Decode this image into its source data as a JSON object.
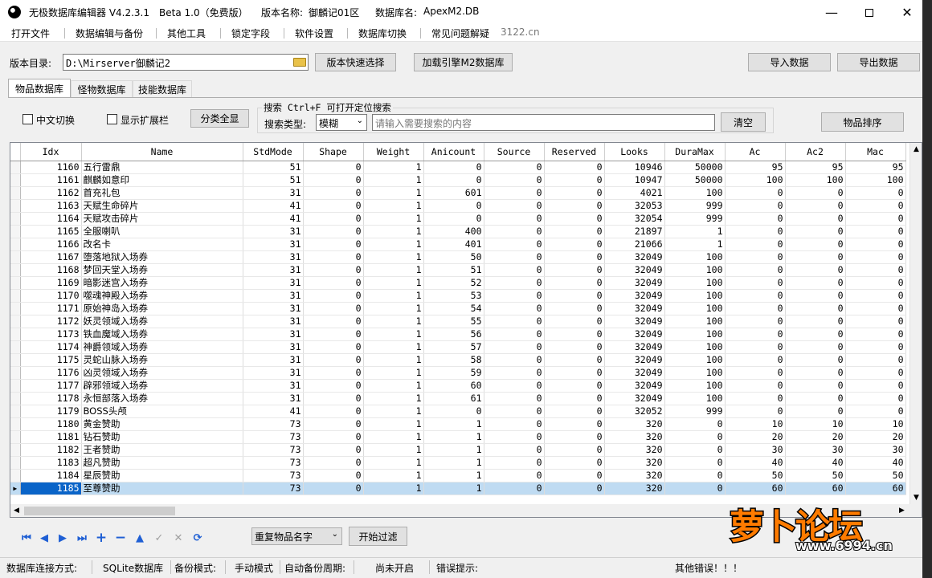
{
  "titlebar": {
    "app_name": "无极数据库编辑器 V4.2.3.1",
    "edition": "Beta 1.0（免费版）",
    "version_label": "版本名称:",
    "version_value": "御麟记01区",
    "db_label": "数据库名:",
    "db_value": "ApexM2.DB"
  },
  "menu": [
    "打开文件",
    "数据编辑与备份",
    "其他工具",
    "锁定字段",
    "软件设置",
    "数据库切换",
    "常见问题解疑"
  ],
  "menu_site": "3122.cn",
  "toolbar": {
    "dir_label": "版本目录:",
    "dir_value": "D:\\Mirserver御麟记2",
    "quick_select": "版本快速选择",
    "load_db": "加载引擎M2数据库",
    "import": "导入数据",
    "export": "导出数据"
  },
  "tabs": [
    "物品数据库",
    "怪物数据库",
    "技能数据库"
  ],
  "filters": {
    "chinese_toggle": "中文切换",
    "show_ext": "显示扩展栏",
    "show_all": "分类全显",
    "search_title": "搜索  Ctrl+F 可打开定位搜索",
    "search_type_label": "搜索类型:",
    "search_type_value": "模糊",
    "search_placeholder": "请输入需要搜索的内容",
    "clear": "清空",
    "sort": "物品排序"
  },
  "grid": {
    "columns": [
      "Idx",
      "Name",
      "StdMode",
      "Shape",
      "Weight",
      "Anicount",
      "Source",
      "Reserved",
      "Looks",
      "DuraMax",
      "Ac",
      "Ac2",
      "Mac"
    ],
    "rows": [
      [
        "1160",
        "五行雷鼎",
        "51",
        "0",
        "1",
        "0",
        "0",
        "0",
        "10946",
        "50000",
        "95",
        "95",
        "95"
      ],
      [
        "1161",
        "麒麟如意印",
        "51",
        "0",
        "1",
        "0",
        "0",
        "0",
        "10947",
        "50000",
        "100",
        "100",
        "100"
      ],
      [
        "1162",
        "首充礼包",
        "31",
        "0",
        "1",
        "601",
        "0",
        "0",
        "4021",
        "100",
        "0",
        "0",
        "0"
      ],
      [
        "1163",
        "天赋生命碎片",
        "41",
        "0",
        "1",
        "0",
        "0",
        "0",
        "32053",
        "999",
        "0",
        "0",
        "0"
      ],
      [
        "1164",
        "天赋攻击碎片",
        "41",
        "0",
        "1",
        "0",
        "0",
        "0",
        "32054",
        "999",
        "0",
        "0",
        "0"
      ],
      [
        "1165",
        "全服喇叭",
        "31",
        "0",
        "1",
        "400",
        "0",
        "0",
        "21897",
        "1",
        "0",
        "0",
        "0"
      ],
      [
        "1166",
        "改名卡",
        "31",
        "0",
        "1",
        "401",
        "0",
        "0",
        "21066",
        "1",
        "0",
        "0",
        "0"
      ],
      [
        "1167",
        "堕落地狱入场券",
        "31",
        "0",
        "1",
        "50",
        "0",
        "0",
        "32049",
        "100",
        "0",
        "0",
        "0"
      ],
      [
        "1168",
        "梦回天堂入场券",
        "31",
        "0",
        "1",
        "51",
        "0",
        "0",
        "32049",
        "100",
        "0",
        "0",
        "0"
      ],
      [
        "1169",
        "暗影迷宫入场券",
        "31",
        "0",
        "1",
        "52",
        "0",
        "0",
        "32049",
        "100",
        "0",
        "0",
        "0"
      ],
      [
        "1170",
        "噬魂神殿入场券",
        "31",
        "0",
        "1",
        "53",
        "0",
        "0",
        "32049",
        "100",
        "0",
        "0",
        "0"
      ],
      [
        "1171",
        "原始神岛入场券",
        "31",
        "0",
        "1",
        "54",
        "0",
        "0",
        "32049",
        "100",
        "0",
        "0",
        "0"
      ],
      [
        "1172",
        "妖灵领域入场券",
        "31",
        "0",
        "1",
        "55",
        "0",
        "0",
        "32049",
        "100",
        "0",
        "0",
        "0"
      ],
      [
        "1173",
        "铁血魔域入场券",
        "31",
        "0",
        "1",
        "56",
        "0",
        "0",
        "32049",
        "100",
        "0",
        "0",
        "0"
      ],
      [
        "1174",
        "神爵领域入场券",
        "31",
        "0",
        "1",
        "57",
        "0",
        "0",
        "32049",
        "100",
        "0",
        "0",
        "0"
      ],
      [
        "1175",
        "灵蛇山脉入场券",
        "31",
        "0",
        "1",
        "58",
        "0",
        "0",
        "32049",
        "100",
        "0",
        "0",
        "0"
      ],
      [
        "1176",
        "凶灵领域入场券",
        "31",
        "0",
        "1",
        "59",
        "0",
        "0",
        "32049",
        "100",
        "0",
        "0",
        "0"
      ],
      [
        "1177",
        "辟邪领域入场券",
        "31",
        "0",
        "1",
        "60",
        "0",
        "0",
        "32049",
        "100",
        "0",
        "0",
        "0"
      ],
      [
        "1178",
        "永恒部落入场券",
        "31",
        "0",
        "1",
        "61",
        "0",
        "0",
        "32049",
        "100",
        "0",
        "0",
        "0"
      ],
      [
        "1179",
        "BOSS头颅",
        "41",
        "0",
        "1",
        "0",
        "0",
        "0",
        "32052",
        "999",
        "0",
        "0",
        "0"
      ],
      [
        "1180",
        "黄金赞助",
        "73",
        "0",
        "1",
        "1",
        "0",
        "0",
        "320",
        "0",
        "10",
        "10",
        "10"
      ],
      [
        "1181",
        "钻石赞助",
        "73",
        "0",
        "1",
        "1",
        "0",
        "0",
        "320",
        "0",
        "20",
        "20",
        "20"
      ],
      [
        "1182",
        "王者赞助",
        "73",
        "0",
        "1",
        "1",
        "0",
        "0",
        "320",
        "0",
        "30",
        "30",
        "30"
      ],
      [
        "1183",
        "超凡赞助",
        "73",
        "0",
        "1",
        "1",
        "0",
        "0",
        "320",
        "0",
        "40",
        "40",
        "40"
      ],
      [
        "1184",
        "星辰赞助",
        "73",
        "0",
        "1",
        "1",
        "0",
        "0",
        "320",
        "0",
        "50",
        "50",
        "50"
      ],
      [
        "1185",
        "至尊赞助",
        "73",
        "0",
        "1",
        "1",
        "0",
        "0",
        "320",
        "0",
        "60",
        "60",
        "60"
      ]
    ],
    "selected_row": 25
  },
  "bottom": {
    "filter_select": "重复物品名字",
    "start_filter": "开始过滤"
  },
  "status": {
    "conn_label": "数据库连接方式:",
    "conn_value": "SQLite数据库",
    "backup_label": "备份模式:",
    "backup_value": "手动模式",
    "auto_label": "自动备份周期:",
    "auto_value": "尚未开启",
    "err_label": "错误提示:",
    "err_value": "其他错误！！！"
  },
  "watermark": {
    "logo_text": "萝卜论坛",
    "url": "www.6994.cn"
  },
  "colors": {
    "selection": "#bfdbf2",
    "nav_blue": "#1f5fd4"
  }
}
